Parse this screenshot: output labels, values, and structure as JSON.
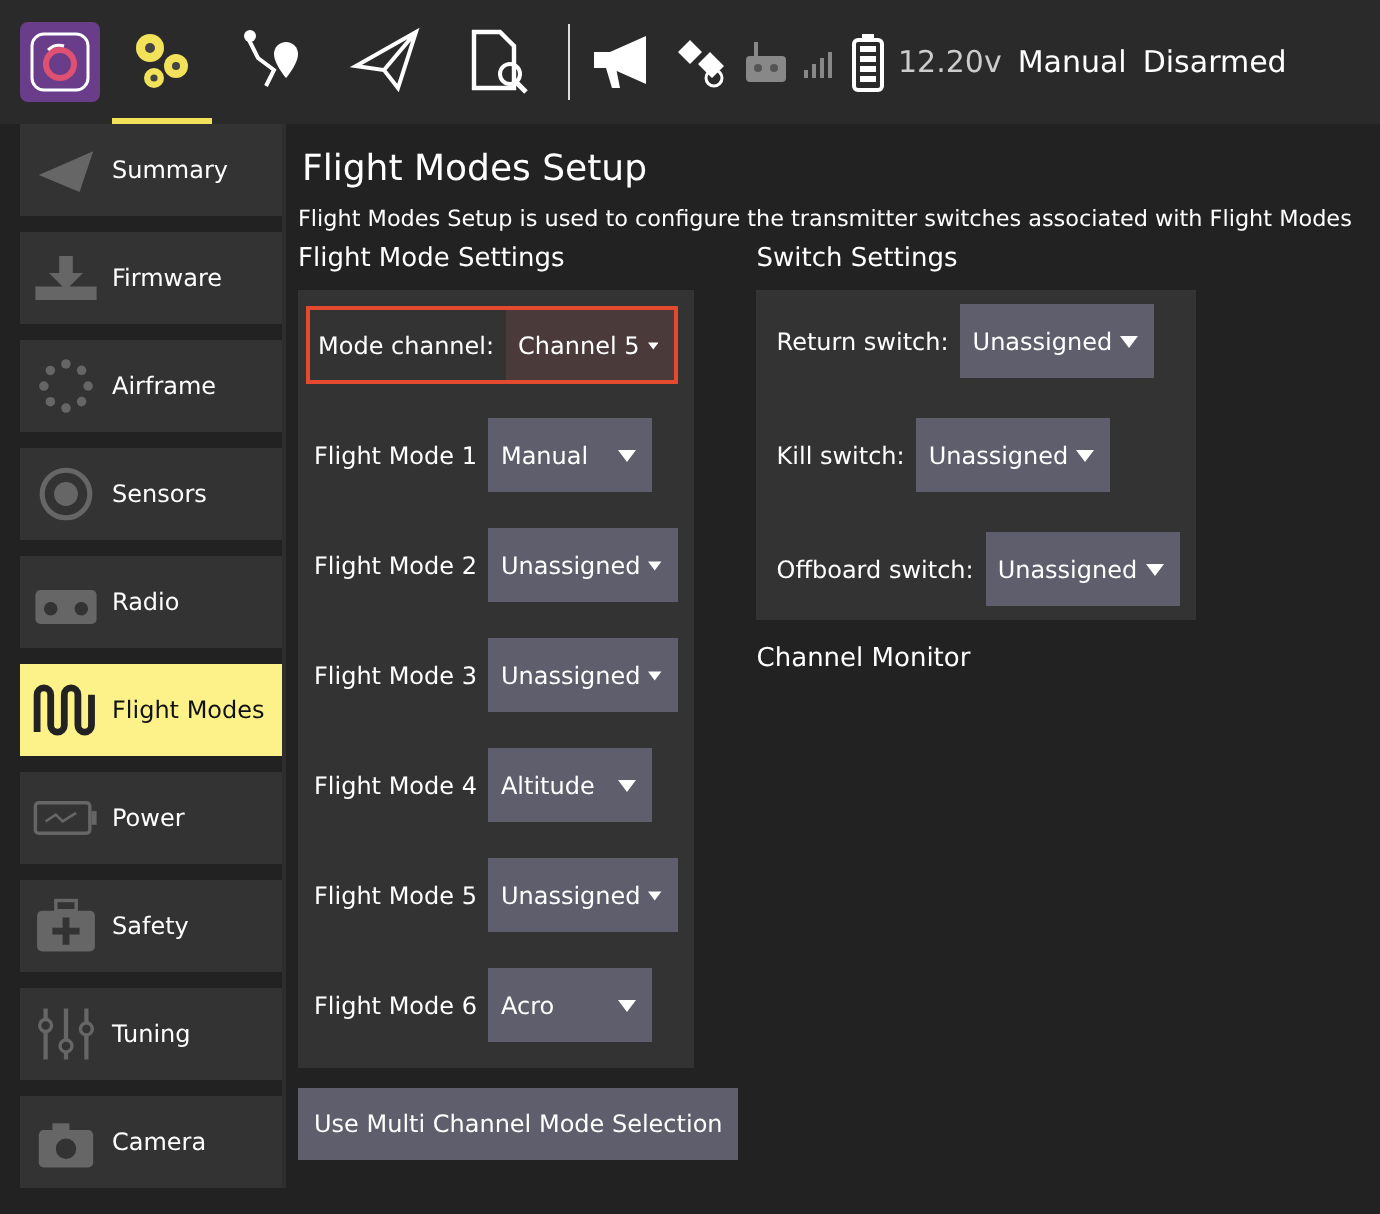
{
  "toolbar": {
    "tools": [
      {
        "kind": "setup",
        "selected": true
      },
      {
        "kind": "plan",
        "selected": false
      },
      {
        "kind": "fly",
        "selected": false
      },
      {
        "kind": "analyze",
        "selected": false
      }
    ],
    "battery_voltage": "12.20v",
    "flight_mode": "Manual",
    "arm_state": "Disarmed"
  },
  "sidebar": {
    "items": [
      {
        "kind": "summary",
        "label": "Summary",
        "selected": false
      },
      {
        "kind": "firmware",
        "label": "Firmware",
        "selected": false
      },
      {
        "kind": "airframe",
        "label": "Airframe",
        "selected": false
      },
      {
        "kind": "sensors",
        "label": "Sensors",
        "selected": false
      },
      {
        "kind": "radio",
        "label": "Radio",
        "selected": false
      },
      {
        "kind": "flightmodes",
        "label": "Flight Modes",
        "selected": true
      },
      {
        "kind": "power",
        "label": "Power",
        "selected": false
      },
      {
        "kind": "safety",
        "label": "Safety",
        "selected": false
      },
      {
        "kind": "tuning",
        "label": "Tuning",
        "selected": false
      },
      {
        "kind": "camera",
        "label": "Camera",
        "selected": false
      }
    ]
  },
  "page": {
    "title": "Flight Modes Setup",
    "description": "Flight Modes Setup is used to configure the transmitter switches associated with Flight Modes",
    "flight_mode_settings": {
      "heading": "Flight Mode Settings",
      "mode_channel": {
        "label": "Mode channel:",
        "value": "Channel 5",
        "highlighted": true
      },
      "modes": [
        {
          "label": "Flight Mode 1",
          "value": "Manual"
        },
        {
          "label": "Flight Mode 2",
          "value": "Unassigned"
        },
        {
          "label": "Flight Mode 3",
          "value": "Unassigned"
        },
        {
          "label": "Flight Mode 4",
          "value": "Altitude"
        },
        {
          "label": "Flight Mode 5",
          "value": "Unassigned"
        },
        {
          "label": "Flight Mode 6",
          "value": "Acro"
        }
      ]
    },
    "switch_settings": {
      "heading": "Switch Settings",
      "switches": [
        {
          "label": "Return switch:",
          "value": "Unassigned"
        },
        {
          "label": "Kill switch:",
          "value": "Unassigned"
        },
        {
          "label": "Offboard switch:",
          "value": "Unassigned"
        }
      ]
    },
    "channel_monitor": {
      "heading": "Channel Monitor"
    },
    "multi_channel_button": "Use Multi Channel Mode Selection"
  }
}
